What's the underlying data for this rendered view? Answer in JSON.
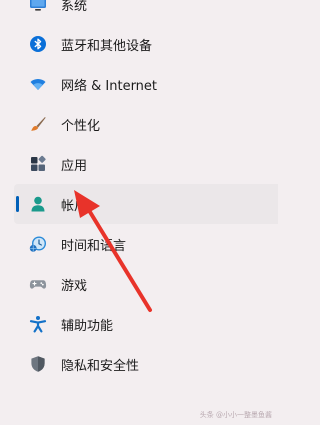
{
  "nav": {
    "items": [
      {
        "label": "系统",
        "icon": "system-monitor-icon"
      },
      {
        "label": "蓝牙和其他设备",
        "icon": "bluetooth-icon"
      },
      {
        "label": "网络 & Internet",
        "icon": "wifi-icon"
      },
      {
        "label": "个性化",
        "icon": "paintbrush-icon"
      },
      {
        "label": "应用",
        "icon": "apps-icon"
      },
      {
        "label": "帐户",
        "icon": "account-icon",
        "selected": true
      },
      {
        "label": "时间和语言",
        "icon": "clock-globe-icon"
      },
      {
        "label": "游戏",
        "icon": "gamepad-icon"
      },
      {
        "label": "辅助功能",
        "icon": "accessibility-icon"
      },
      {
        "label": "隐私和安全性",
        "icon": "shield-icon"
      }
    ]
  },
  "colors": {
    "background": "#f3eef0",
    "selected_background": "#ebe7e9",
    "selection_indicator": "#005fb8",
    "annotation_arrow": "#e8332a"
  },
  "watermark": "头条 @小小一整墨鱼酱"
}
